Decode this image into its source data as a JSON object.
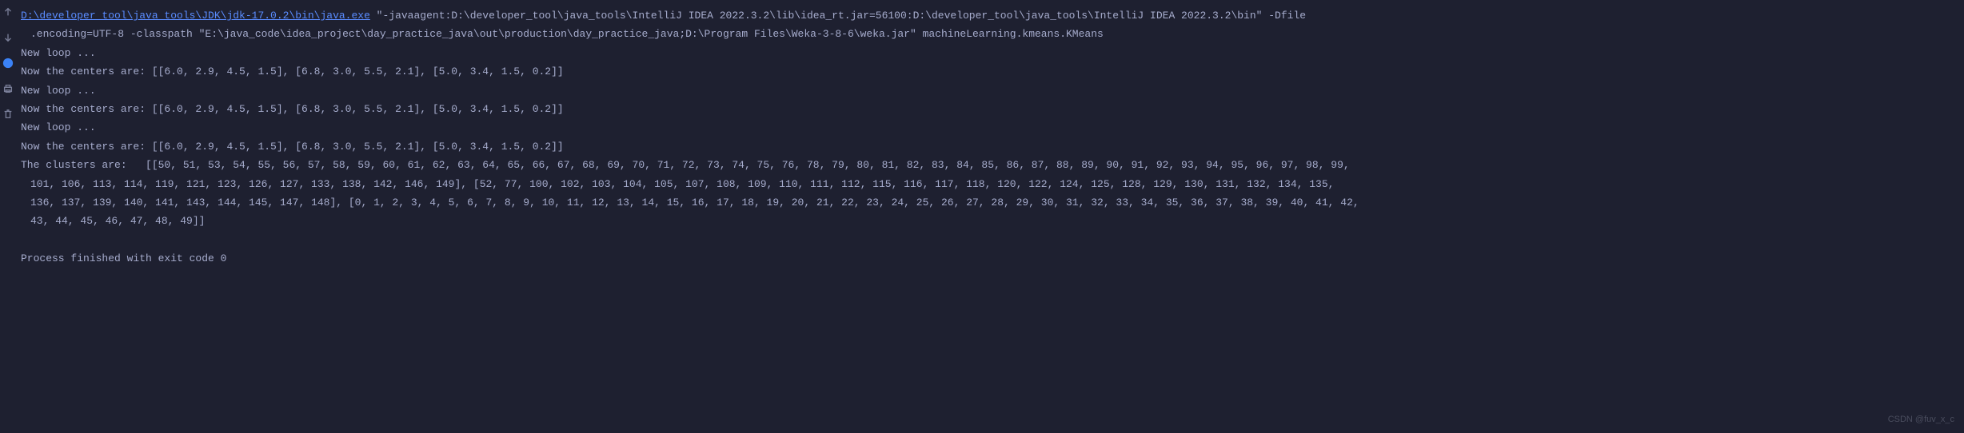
{
  "gutter": {
    "icons": [
      "up-arrow",
      "down-arrow",
      "wrap-text",
      "print",
      "trash"
    ]
  },
  "command": {
    "java_path": "D:\\developer_tool\\java_tools\\JDK\\jdk-17.0.2\\bin\\java.exe",
    "args_line1": " \"-javaagent:D:\\developer_tool\\java_tools\\IntelliJ IDEA 2022.3.2\\lib\\idea_rt.jar=56100:D:\\developer_tool\\java_tools\\IntelliJ IDEA 2022.3.2\\bin\" -Dfile",
    "args_line2": ".encoding=UTF-8 -classpath \"E:\\java_code\\idea_project\\day_practice_java\\out\\production\\day_practice_java;D:\\Program Files\\Weka-3-8-6\\weka.jar\" machineLearning.kmeans.KMeans"
  },
  "output": {
    "lines": [
      "New loop ...",
      "Now the centers are: [[6.0, 2.9, 4.5, 1.5], [6.8, 3.0, 5.5, 2.1], [5.0, 3.4, 1.5, 0.2]]",
      "New loop ...",
      "Now the centers are: [[6.0, 2.9, 4.5, 1.5], [6.8, 3.0, 5.5, 2.1], [5.0, 3.4, 1.5, 0.2]]",
      "New loop ...",
      "Now the centers are: [[6.0, 2.9, 4.5, 1.5], [6.8, 3.0, 5.5, 2.1], [5.0, 3.4, 1.5, 0.2]]"
    ],
    "clusters_line1": "The clusters are:   [[50, 51, 53, 54, 55, 56, 57, 58, 59, 60, 61, 62, 63, 64, 65, 66, 67, 68, 69, 70, 71, 72, 73, 74, 75, 76, 78, 79, 80, 81, 82, 83, 84, 85, 86, 87, 88, 89, 90, 91, 92, 93, 94, 95, 96, 97, 98, 99, ",
    "clusters_line2": "101, 106, 113, 114, 119, 121, 123, 126, 127, 133, 138, 142, 146, 149], [52, 77, 100, 102, 103, 104, 105, 107, 108, 109, 110, 111, 112, 115, 116, 117, 118, 120, 122, 124, 125, 128, 129, 130, 131, 132, 134, 135, ",
    "clusters_line3": "136, 137, 139, 140, 141, 143, 144, 145, 147, 148], [0, 1, 2, 3, 4, 5, 6, 7, 8, 9, 10, 11, 12, 13, 14, 15, 16, 17, 18, 19, 20, 21, 22, 23, 24, 25, 26, 27, 28, 29, 30, 31, 32, 33, 34, 35, 36, 37, 38, 39, 40, 41, 42, ",
    "clusters_line4": "43, 44, 45, 46, 47, 48, 49]]",
    "exit_message": "Process finished with exit code 0"
  },
  "watermark": "CSDN @fuv_x_c"
}
